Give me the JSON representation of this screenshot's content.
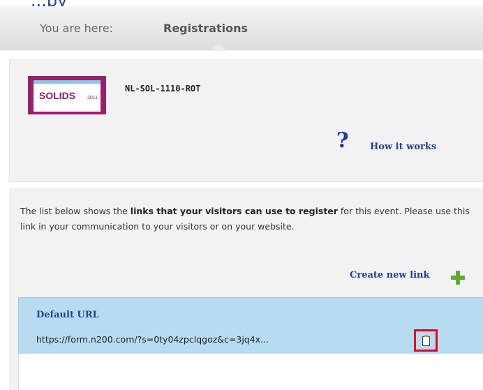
{
  "top_strip_text": "...py",
  "breadcrumb": {
    "label": "You are here:",
    "current": "Registrations"
  },
  "event": {
    "logo_text": "SOLIDS",
    "logo_year": "2011",
    "code": "NL-SOL-1110-ROT",
    "help_link": "How it works"
  },
  "links": {
    "intro_part1": "The list below shows the ",
    "intro_bold": "links that your visitors can use to register",
    "intro_part2": " for this event. Please use this link in your communication to your visitors or on your website.",
    "create_link": "Create new link",
    "items": [
      {
        "name": "Default URL",
        "url": "https://form.n200.com/?s=0ty04zpclqgoz&c=3jq4x..."
      }
    ]
  },
  "icons": {
    "help": "help-question-icon",
    "add": "plus-icon",
    "copy": "clipboard-copy-icon"
  },
  "colors": {
    "link": "#26408f",
    "card": "#b7dcf1",
    "highlight": "#e8001c",
    "plus": "#5cad2e"
  }
}
